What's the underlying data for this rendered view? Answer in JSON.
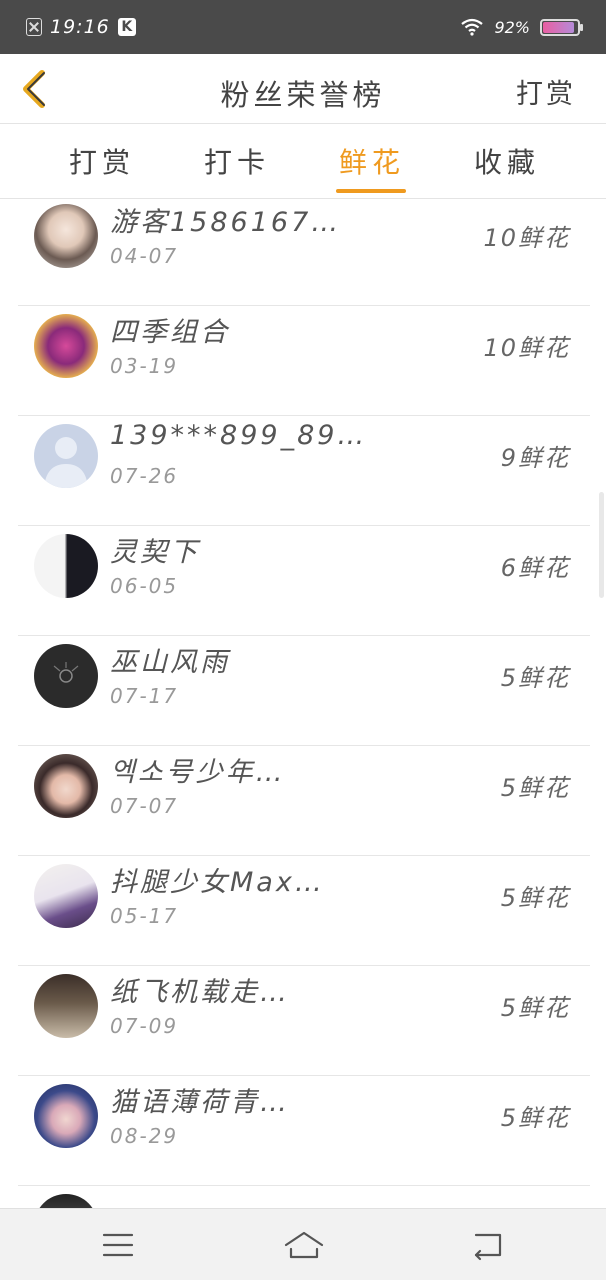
{
  "status_bar": {
    "time": "19:16",
    "k_badge": "K",
    "battery_text": "92%",
    "battery_level": 0.92
  },
  "header": {
    "title": "粉丝荣誉榜",
    "action": "打赏"
  },
  "tabs": [
    {
      "label": "打赏",
      "active": false
    },
    {
      "label": "打卡",
      "active": false
    },
    {
      "label": "鲜花",
      "active": true
    },
    {
      "label": "收藏",
      "active": false
    }
  ],
  "list": [
    {
      "name": "游客1586167…",
      "date": "04-07",
      "count": "10鲜花"
    },
    {
      "name": "四季组合",
      "date": "03-19",
      "count": "10鲜花"
    },
    {
      "name": "139***899_89…",
      "date": "07-26",
      "count": "9鲜花"
    },
    {
      "name": "灵契下",
      "date": "06-05",
      "count": "6鲜花"
    },
    {
      "name": "巫山风雨",
      "date": "07-17",
      "count": "5鲜花"
    },
    {
      "name": "엑소号少年…",
      "date": "07-07",
      "count": "5鲜花"
    },
    {
      "name": "抖腿少女Max…",
      "date": "05-17",
      "count": "5鲜花"
    },
    {
      "name": "纸飞机载走…",
      "date": "07-09",
      "count": "5鲜花"
    },
    {
      "name": "猫语薄荷青…",
      "date": "08-29",
      "count": "5鲜花"
    },
    {
      "name": "",
      "date": "",
      "count": ""
    }
  ],
  "colors": {
    "accent": "#ef9a1f",
    "status_bar_bg": "#4a4a4a",
    "divider": "#e6e6e6"
  },
  "icons": {
    "back": "chevron-left-icon",
    "nav_menu": "menu-icon",
    "nav_home": "home-icon",
    "nav_back": "return-icon"
  }
}
